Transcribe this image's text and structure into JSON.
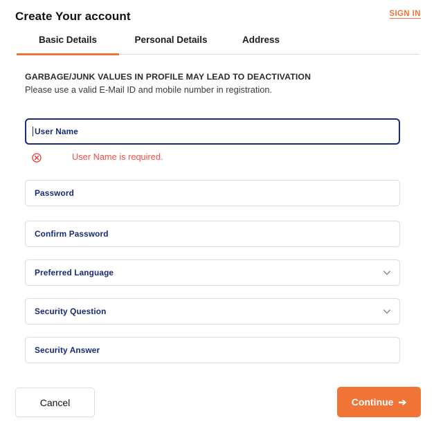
{
  "header": {
    "title": "Create Your account",
    "signin_label": "SIGN IN"
  },
  "tabs": [
    {
      "label": "Basic Details",
      "active": true
    },
    {
      "label": "Personal Details",
      "active": false
    },
    {
      "label": "Address",
      "active": false
    }
  ],
  "notice": {
    "headline": "GARBAGE/JUNK VALUES IN PROFILE MAY LEAD TO DEACTIVATION",
    "subline": "Please use a valid E-Mail ID and mobile number in registration."
  },
  "form": {
    "fields": [
      {
        "name": "user-name",
        "placeholder": "User Name",
        "value": "",
        "type": "text",
        "focused": true,
        "has_error": true
      },
      {
        "name": "password",
        "placeholder": "Password",
        "value": "",
        "type": "password",
        "focused": false,
        "has_error": false
      },
      {
        "name": "confirm-password",
        "placeholder": "Confirm Password",
        "value": "",
        "type": "password",
        "focused": false,
        "has_error": false
      },
      {
        "name": "preferred-language",
        "placeholder": "Preferred Language",
        "value": "",
        "type": "select",
        "focused": false,
        "has_error": false
      },
      {
        "name": "security-question",
        "placeholder": "Security Question",
        "value": "",
        "type": "select",
        "focused": false,
        "has_error": false
      },
      {
        "name": "security-answer",
        "placeholder": "Security Answer",
        "value": "",
        "type": "text",
        "focused": false,
        "has_error": false
      }
    ],
    "error": {
      "icon": "error-circle-x-icon",
      "message": "User Name is required."
    }
  },
  "footer": {
    "cancel_label": "Cancel",
    "continue_label": "Continue",
    "continue_icon": "arrow-right-icon"
  },
  "icons": {
    "chevron_down": "chevron-down-icon",
    "arrow_right": "➔"
  },
  "colors": {
    "accent_orange": "#ef7436",
    "field_label_navy": "#17297b",
    "focus_border_navy": "#172a7c",
    "error_red": "#fb4c4c",
    "border_gray": "#dcdcdc",
    "title_black": "#111111"
  }
}
